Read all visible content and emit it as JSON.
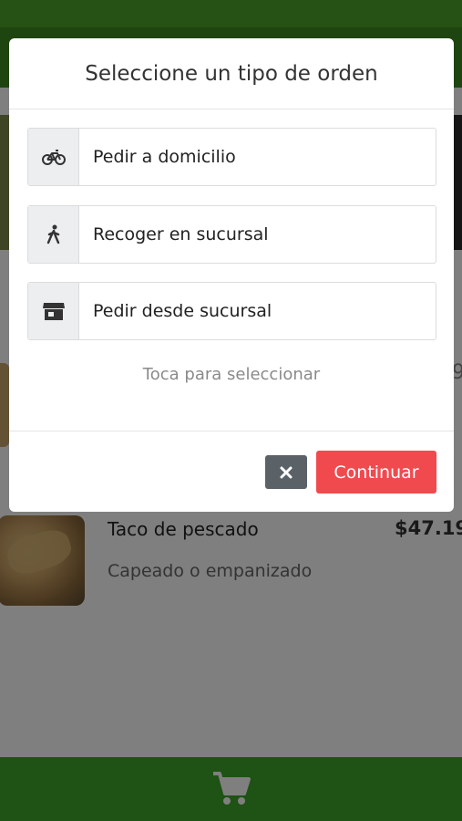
{
  "modal": {
    "title": "Seleccione un tipo de orden",
    "options": [
      {
        "label": "Pedir a domicilio",
        "icon": "bicycle-icon"
      },
      {
        "label": "Recoger en sucursal",
        "icon": "walking-person-icon"
      },
      {
        "label": "Pedir desde sucursal",
        "icon": "store-icon"
      }
    ],
    "hint": "Toca para seleccionar",
    "continue_label": "Continuar",
    "close_icon": "close-icon"
  },
  "background": {
    "product": {
      "name": "Taco de pescado",
      "price": "$47.19",
      "description": "Capeado o empanizado"
    },
    "partial_price": "9",
    "cart_icon": "shopping-cart-icon"
  },
  "colors": {
    "brand_green": "#4fa52a",
    "continue_red": "#f04a4f",
    "close_gray": "#5a6268"
  }
}
